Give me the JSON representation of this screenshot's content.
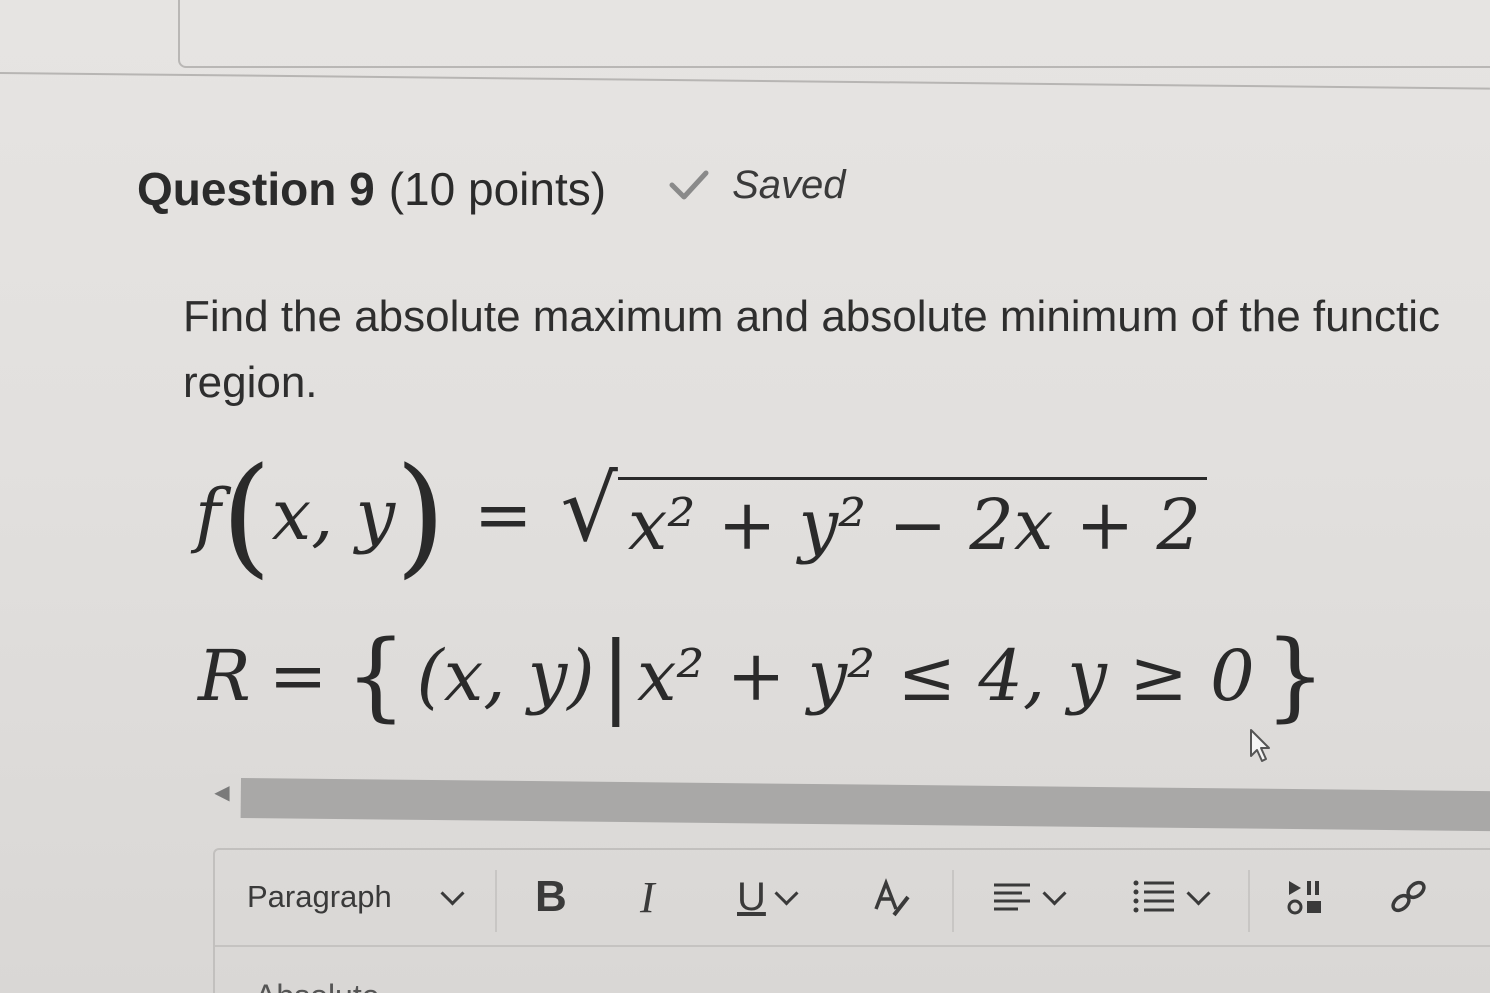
{
  "question": {
    "title": "Question 9",
    "points": "(10 points)",
    "status": "Saved",
    "status_icon": "checkmark-icon"
  },
  "prompt": {
    "line1": "Find the absolute maximum and absolute minimum of the functic",
    "line2": "region."
  },
  "math": {
    "function_lhs_name": "f",
    "function_args": "x, y",
    "function_rhs": "x² + y² − 2x + 2",
    "region_name": "R",
    "region_set": "(x, y)",
    "region_condition": "x² + y² ≤ 4, y ≥ 0"
  },
  "editor": {
    "paragraph_label": "Paragraph",
    "bold_label": "B",
    "italic_label": "I",
    "underline_label": "U",
    "font_color_label": "A",
    "content_peek": "Absolute..."
  },
  "icons": {
    "scroll_left": "scroll-left-arrow-icon",
    "cursor": "mouse-cursor-icon",
    "align": "align-icon",
    "list": "list-icon",
    "media": "media-icon",
    "link": "link-icon"
  }
}
